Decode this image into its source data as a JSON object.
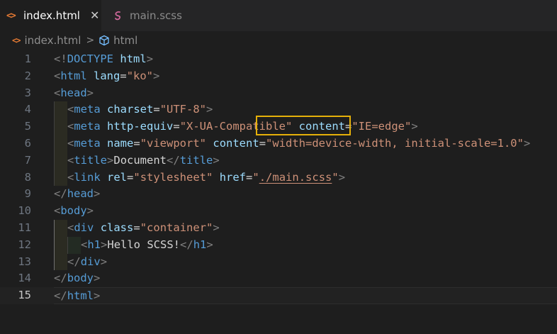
{
  "tabs": [
    {
      "label": "index.html",
      "icon": "html-file-icon",
      "active": true,
      "close": "✕"
    },
    {
      "label": "main.scss",
      "icon": "scss-file-icon",
      "active": false
    }
  ],
  "breadcrumb": {
    "file": "index.html",
    "separator": ">",
    "symbol": "html"
  },
  "editor": {
    "current_line": 15,
    "lines": [
      {
        "n": "1",
        "code": "<!DOCTYPE html>"
      },
      {
        "n": "2",
        "code": "<html lang=\"ko\">"
      },
      {
        "n": "3",
        "code": "<head>"
      },
      {
        "n": "4",
        "code": "<meta charset=\"UTF-8\">"
      },
      {
        "n": "5",
        "code": "<meta http-equiv=\"X-UA-Compatible\" content=\"IE=edge\">"
      },
      {
        "n": "6",
        "code": "<meta name=\"viewport\" content=\"width=device-width, initial-scale=1.0\">"
      },
      {
        "n": "7",
        "code": "<title>Document</title>"
      },
      {
        "n": "8",
        "code": "<link rel=\"stylesheet\" href=\"./main.scss\">"
      },
      {
        "n": "9",
        "code": "</head>"
      },
      {
        "n": "10",
        "code": "<body>"
      },
      {
        "n": "11",
        "code": "<div class=\"container\">"
      },
      {
        "n": "12",
        "code": "<h1>Hello SCSS!</h1>"
      },
      {
        "n": "13",
        "code": "</div>"
      },
      {
        "n": "14",
        "code": "</body>"
      },
      {
        "n": "15",
        "code": "</html>"
      }
    ]
  },
  "colors": {
    "background": "#1e1e1e",
    "tag": "#569cd6",
    "attribute": "#9cdcfe",
    "string": "#ce9178",
    "punctuation": "#808080",
    "highlight_box": "#e5b009",
    "html_icon": "#e37933",
    "scss_icon": "#cd6799"
  }
}
